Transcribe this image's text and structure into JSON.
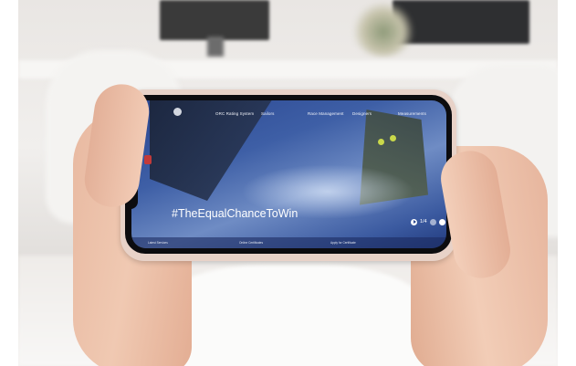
{
  "nav": {
    "items": [
      "ORC Rating System",
      "Sailors",
      "Race Management",
      "Designers",
      "Measurements"
    ]
  },
  "hero": {
    "headline": "#TheEqualChanceToWin",
    "slide_counter": "1/4"
  },
  "footer": {
    "links": [
      "Latest Services",
      "Online Certificates",
      "Apply for Certificate"
    ]
  },
  "colors": {
    "screen_blue": "#3e5fa6",
    "phone_case": "#e8d2c8",
    "accent_green": "#c9d84a"
  }
}
